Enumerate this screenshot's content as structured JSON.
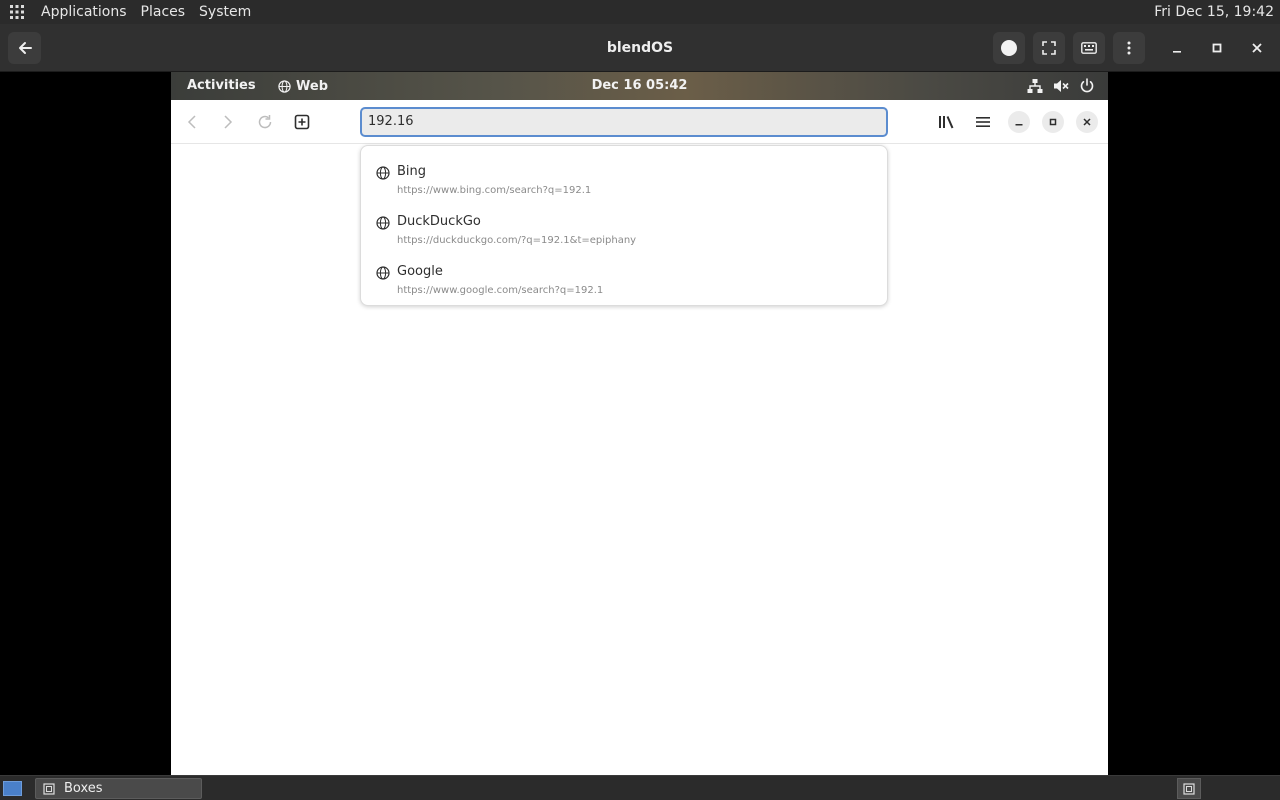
{
  "host_panel": {
    "menus": [
      "Applications",
      "Places",
      "System"
    ],
    "clock": "Fri Dec 15, 19:42"
  },
  "boxes_window": {
    "title": "blendOS"
  },
  "guest": {
    "top_bar": {
      "activities": "Activities",
      "app_name": "Web",
      "clock": "Dec 16  05:42"
    },
    "browser": {
      "url_value": "192.16",
      "suggestions": [
        {
          "name": "Bing",
          "url": "https://www.bing.com/search?q=192.1"
        },
        {
          "name": "DuckDuckGo",
          "url": "https://duckduckgo.com/?q=192.1&t=epiphany"
        },
        {
          "name": "Google",
          "url": "https://www.google.com/search?q=192.1"
        }
      ]
    }
  },
  "taskbar": {
    "task_label": "Boxes"
  },
  "colors": {
    "url_focus": "#5b8ccf",
    "host_panel": "#2b2b2b",
    "header": "#303030"
  }
}
